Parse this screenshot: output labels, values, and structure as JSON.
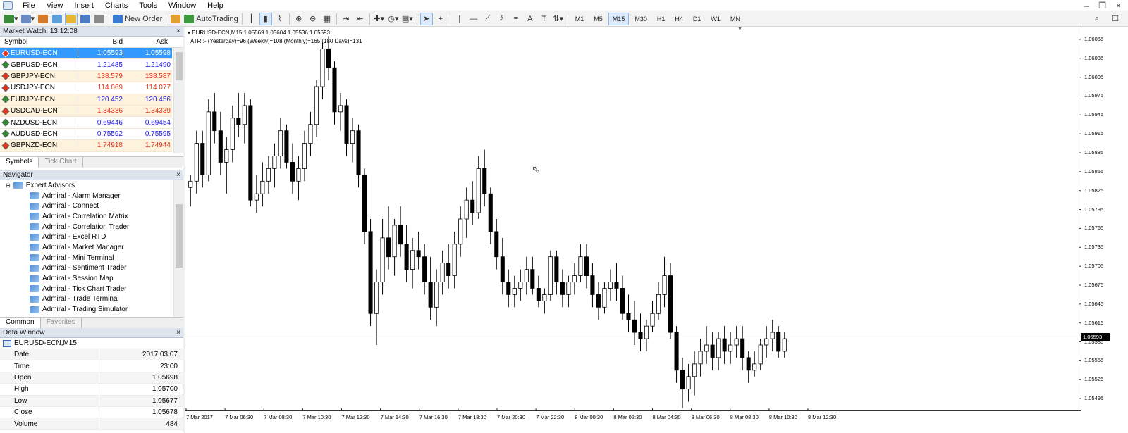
{
  "menu": {
    "items": [
      "File",
      "View",
      "Insert",
      "Charts",
      "Tools",
      "Window",
      "Help"
    ]
  },
  "toolbar": {
    "new_order": "New Order",
    "auto_trading": "AutoTrading",
    "timeframes": [
      "M1",
      "M5",
      "M15",
      "M30",
      "H1",
      "H4",
      "D1",
      "W1",
      "MN"
    ],
    "active_tf": "M15",
    "text_tool": "A"
  },
  "market_watch": {
    "title": "Market Watch: 13:12:08",
    "headers": {
      "symbol": "Symbol",
      "bid": "Bid",
      "ask": "Ask"
    },
    "rows": [
      {
        "symbol": "EURUSD-ECN",
        "bid": "1.05593",
        "ask": "1.05598",
        "dir": "up",
        "selected": true
      },
      {
        "symbol": "GBPUSD-ECN",
        "bid": "1.21485",
        "ask": "1.21490",
        "dir": "up"
      },
      {
        "symbol": "GBPJPY-ECN",
        "bid": "138.579",
        "ask": "138.587",
        "dir": "dn"
      },
      {
        "symbol": "USDJPY-ECN",
        "bid": "114.069",
        "ask": "114.077",
        "dir": "dn"
      },
      {
        "symbol": "EURJPY-ECN",
        "bid": "120.452",
        "ask": "120.456",
        "dir": "up"
      },
      {
        "symbol": "USDCAD-ECN",
        "bid": "1.34336",
        "ask": "1.34339",
        "dir": "dn"
      },
      {
        "symbol": "NZDUSD-ECN",
        "bid": "0.69446",
        "ask": "0.69454",
        "dir": "up"
      },
      {
        "symbol": "AUDUSD-ECN",
        "bid": "0.75592",
        "ask": "0.75595",
        "dir": "up"
      },
      {
        "symbol": "GBPNZD-ECN",
        "bid": "1.74918",
        "ask": "1.74944",
        "dir": "dn"
      }
    ],
    "tabs": [
      "Symbols",
      "Tick Chart"
    ]
  },
  "navigator": {
    "title": "Navigator",
    "root": "Expert Advisors",
    "items": [
      "Admiral - Alarm Manager",
      "Admiral - Connect",
      "Admiral - Correlation Matrix",
      "Admiral - Correlation Trader",
      "Admiral - Excel RTD",
      "Admiral - Market Manager",
      "Admiral - Mini Terminal",
      "Admiral - Sentiment Trader",
      "Admiral - Session Map",
      "Admiral - Tick Chart Trader",
      "Admiral - Trade Terminal",
      "Admiral - Trading Simulator"
    ],
    "tabs": [
      "Common",
      "Favorites"
    ]
  },
  "data_window": {
    "title": "Data Window",
    "symbol": "EURUSD-ECN,M15",
    "rows": [
      {
        "k": "Date",
        "v": "2017.03.07"
      },
      {
        "k": "Time",
        "v": "23:00"
      },
      {
        "k": "Open",
        "v": "1.05698"
      },
      {
        "k": "High",
        "v": "1.05700"
      },
      {
        "k": "Low",
        "v": "1.05677"
      },
      {
        "k": "Close",
        "v": "1.05678"
      },
      {
        "k": "Volume",
        "v": "484"
      }
    ]
  },
  "chart": {
    "header": "EURUSD-ECN,M15  1.05569 1.05604 1.05536 1.05593",
    "indicator": "ATR :- (Yesterday)=96       (Weekly)=108       (Monthly)=165       (180 Days)=131",
    "current_price": "1.05593",
    "current_price_value": 1.05593,
    "price_labels": [
      "1.06065",
      "1.06035",
      "1.06005",
      "1.05975",
      "1.05945",
      "1.05915",
      "1.05885",
      "1.05855",
      "1.05825",
      "1.05795",
      "1.05765",
      "1.05735",
      "1.05705",
      "1.05675",
      "1.05645",
      "1.05615",
      "1.05585",
      "1.05555",
      "1.05525",
      "1.05495"
    ],
    "time_labels": [
      "7 Mar 2017",
      "7 Mar 06:30",
      "7 Mar 08:30",
      "7 Mar 10:30",
      "7 Mar 12:30",
      "7 Mar 14:30",
      "7 Mar 16:30",
      "7 Mar 18:30",
      "7 Mar 20:30",
      "7 Mar 22:30",
      "8 Mar 00:30",
      "8 Mar 02:30",
      "8 Mar 04:30",
      "8 Mar 06:30",
      "8 Mar 08:30",
      "8 Mar 10:30",
      "8 Mar 12:30"
    ]
  },
  "chart_data": {
    "type": "candlestick",
    "title": "EURUSD-ECN,M15",
    "ylim": [
      1.05475,
      1.06085
    ],
    "candles": [
      [
        1.0583,
        1.0585,
        1.058,
        1.0584
      ],
      [
        1.0584,
        1.0592,
        1.0582,
        1.059
      ],
      [
        1.059,
        1.0592,
        1.0583,
        1.0585
      ],
      [
        1.0585,
        1.0597,
        1.0584,
        1.0595
      ],
      [
        1.0595,
        1.0598,
        1.059,
        1.0592
      ],
      [
        1.0592,
        1.0595,
        1.0585,
        1.0587
      ],
      [
        1.0587,
        1.0591,
        1.0582,
        1.0589
      ],
      [
        1.0589,
        1.0596,
        1.0587,
        1.0594
      ],
      [
        1.0594,
        1.0598,
        1.0591,
        1.0593
      ],
      [
        1.0593,
        1.0598,
        1.059,
        1.0596
      ],
      [
        1.0596,
        1.0597,
        1.058,
        1.0581
      ],
      [
        1.0581,
        1.0585,
        1.0579,
        1.0582
      ],
      [
        1.0582,
        1.0587,
        1.058,
        1.0584
      ],
      [
        1.0584,
        1.0588,
        1.0582,
        1.0586
      ],
      [
        1.0586,
        1.059,
        1.0583,
        1.0588
      ],
      [
        1.0588,
        1.0594,
        1.0586,
        1.0592
      ],
      [
        1.0592,
        1.0593,
        1.0586,
        1.0587
      ],
      [
        1.0587,
        1.059,
        1.0582,
        1.0584
      ],
      [
        1.0584,
        1.0588,
        1.0581,
        1.0586
      ],
      [
        1.0586,
        1.0592,
        1.0584,
        1.059
      ],
      [
        1.059,
        1.0595,
        1.0588,
        1.0593
      ],
      [
        1.0593,
        1.06,
        1.0591,
        1.0599
      ],
      [
        1.0599,
        1.0606,
        1.0597,
        1.0605
      ],
      [
        1.0605,
        1.0607,
        1.06,
        1.0602
      ],
      [
        1.0602,
        1.0603,
        1.0593,
        1.0595
      ],
      [
        1.0595,
        1.0598,
        1.0592,
        1.0596
      ],
      [
        1.0596,
        1.0597,
        1.0588,
        1.059
      ],
      [
        1.059,
        1.0594,
        1.0587,
        1.0592
      ],
      [
        1.0592,
        1.0593,
        1.0583,
        1.0585
      ],
      [
        1.0585,
        1.0586,
        1.0574,
        1.0576
      ],
      [
        1.0576,
        1.0578,
        1.0561,
        1.0563
      ],
      [
        1.0563,
        1.057,
        1.0558,
        1.0568
      ],
      [
        1.0568,
        1.0578,
        1.0566,
        1.0575
      ],
      [
        1.0575,
        1.058,
        1.057,
        1.0572
      ],
      [
        1.0572,
        1.0578,
        1.0569,
        1.0577
      ],
      [
        1.0577,
        1.058,
        1.0572,
        1.0574
      ],
      [
        1.0574,
        1.0577,
        1.0568,
        1.057
      ],
      [
        1.057,
        1.0575,
        1.0567,
        1.0573
      ],
      [
        1.0573,
        1.0576,
        1.057,
        1.0572
      ],
      [
        1.0572,
        1.0574,
        1.0566,
        1.0568
      ],
      [
        1.0568,
        1.0572,
        1.0562,
        1.0564
      ],
      [
        1.0564,
        1.057,
        1.0561,
        1.0568
      ],
      [
        1.0568,
        1.0573,
        1.0566,
        1.0571
      ],
      [
        1.0571,
        1.0574,
        1.0567,
        1.0569
      ],
      [
        1.0569,
        1.0576,
        1.0567,
        1.0574
      ],
      [
        1.0574,
        1.058,
        1.0572,
        1.0578
      ],
      [
        1.0578,
        1.0583,
        1.0575,
        1.0581
      ],
      [
        1.0581,
        1.0584,
        1.0577,
        1.0579
      ],
      [
        1.0579,
        1.0588,
        1.0578,
        1.0586
      ],
      [
        1.0586,
        1.0589,
        1.058,
        1.0582
      ],
      [
        1.0582,
        1.0583,
        1.0574,
        1.0576
      ],
      [
        1.0576,
        1.0578,
        1.057,
        1.0572
      ],
      [
        1.0572,
        1.0575,
        1.0566,
        1.0568
      ],
      [
        1.0568,
        1.057,
        1.0564,
        1.0566
      ],
      [
        1.0566,
        1.0569,
        1.0564,
        1.0567
      ],
      [
        1.0567,
        1.057,
        1.0565,
        1.0568
      ],
      [
        1.0568,
        1.0572,
        1.0566,
        1.057
      ],
      [
        1.057,
        1.0572,
        1.0566,
        1.0567
      ],
      [
        1.0567,
        1.0569,
        1.0564,
        1.0565
      ],
      [
        1.0565,
        1.0567,
        1.0563,
        1.0566
      ],
      [
        1.0566,
        1.0573,
        1.0565,
        1.0572
      ],
      [
        1.0572,
        1.0573,
        1.0566,
        1.0568
      ],
      [
        1.0568,
        1.057,
        1.0564,
        1.0566
      ],
      [
        1.0566,
        1.0569,
        1.0564,
        1.0568
      ],
      [
        1.0568,
        1.0571,
        1.0566,
        1.0569
      ],
      [
        1.0569,
        1.0574,
        1.0568,
        1.0572
      ],
      [
        1.0572,
        1.0574,
        1.0567,
        1.0569
      ],
      [
        1.0569,
        1.0571,
        1.0564,
        1.0566
      ],
      [
        1.0566,
        1.0568,
        1.0562,
        1.0564
      ],
      [
        1.0564,
        1.0568,
        1.0563,
        1.0567
      ],
      [
        1.0567,
        1.057,
        1.0565,
        1.0568
      ],
      [
        1.0568,
        1.0571,
        1.0565,
        1.0567
      ],
      [
        1.0567,
        1.0569,
        1.0562,
        1.0563
      ],
      [
        1.0563,
        1.0566,
        1.056,
        1.0562
      ],
      [
        1.0562,
        1.0565,
        1.0558,
        1.056
      ],
      [
        1.056,
        1.0563,
        1.0557,
        1.0559
      ],
      [
        1.0559,
        1.0562,
        1.0557,
        1.0561
      ],
      [
        1.0561,
        1.0565,
        1.056,
        1.0563
      ],
      [
        1.0563,
        1.0568,
        1.0562,
        1.0566
      ],
      [
        1.0566,
        1.0572,
        1.0564,
        1.0569
      ],
      [
        1.0569,
        1.0571,
        1.0559,
        1.056
      ],
      [
        1.056,
        1.0561,
        1.0552,
        1.0554
      ],
      [
        1.0554,
        1.0556,
        1.0548,
        1.0551
      ],
      [
        1.0551,
        1.0555,
        1.0549,
        1.0553
      ],
      [
        1.0553,
        1.0557,
        1.055,
        1.0555
      ],
      [
        1.0555,
        1.0559,
        1.0553,
        1.0557
      ],
      [
        1.0557,
        1.0561,
        1.0555,
        1.0558
      ],
      [
        1.0558,
        1.056,
        1.0554,
        1.0556
      ],
      [
        1.0556,
        1.056,
        1.0554,
        1.0559
      ],
      [
        1.0559,
        1.0561,
        1.0555,
        1.0557
      ],
      [
        1.0557,
        1.056,
        1.0555,
        1.0558
      ],
      [
        1.0558,
        1.0561,
        1.0556,
        1.0559
      ],
      [
        1.0559,
        1.0561,
        1.0554,
        1.0556
      ],
      [
        1.0556,
        1.0557,
        1.0552,
        1.0554
      ],
      [
        1.0554,
        1.0557,
        1.0553,
        1.0555
      ],
      [
        1.0555,
        1.0559,
        1.0554,
        1.0558
      ],
      [
        1.0558,
        1.0561,
        1.0556,
        1.0559
      ],
      [
        1.0559,
        1.0562,
        1.0557,
        1.056
      ],
      [
        1.056,
        1.0561,
        1.0556,
        1.0557
      ],
      [
        1.0557,
        1.056,
        1.0556,
        1.0559
      ]
    ]
  }
}
